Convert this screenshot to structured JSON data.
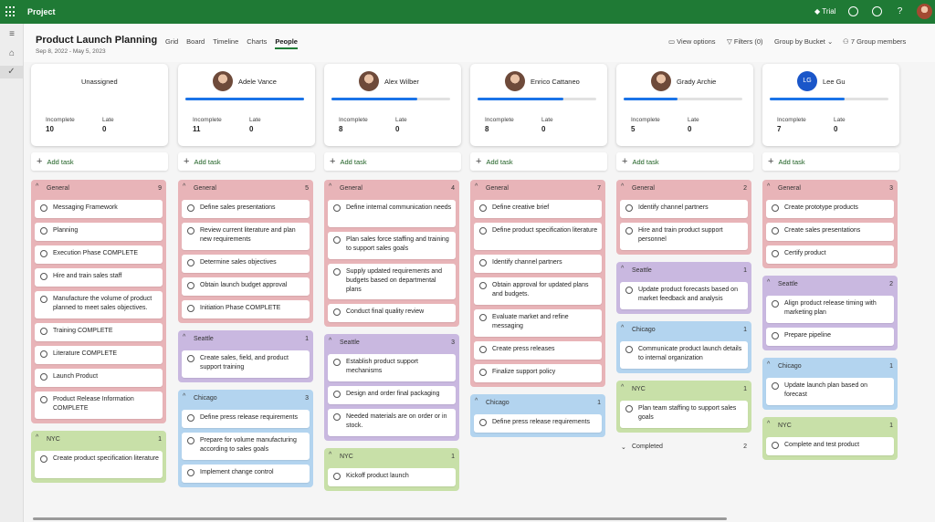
{
  "app": {
    "name": "Project",
    "trial": "Trial"
  },
  "plan": {
    "title": "Product Launch Planning",
    "date_range": "Sep 8, 2022 - May 5, 2023"
  },
  "tabs": [
    {
      "label": "Grid"
    },
    {
      "label": "Board"
    },
    {
      "label": "Timeline"
    },
    {
      "label": "Charts"
    },
    {
      "label": "People",
      "active": true
    }
  ],
  "controls": {
    "view_options": "View options",
    "filters": "Filters (0)",
    "group_by": "Group by Bucket",
    "members": "7 Group members"
  },
  "labels": {
    "incomplete": "Incomplete",
    "late": "Late",
    "add_task": "Add task",
    "completed": "Completed"
  },
  "colors": {
    "topbar": "#1f7a35",
    "progress": "#1a73e8",
    "general": "#e8b4b8",
    "seattle": "#c9b8e0",
    "chicago": "#b3d4ef",
    "nyc": "#c8e0a8"
  },
  "columns": [
    {
      "name": "Unassigned",
      "avatar": "none",
      "progress": 0,
      "incomplete": "10",
      "late": "0",
      "buckets": [
        {
          "name": "General",
          "count": "9",
          "tasks": [
            "Messaging Framework",
            "Planning",
            "Execution Phase COMPLETE",
            "Hire and train sales staff",
            "Manufacture the volume of product planned to meet sales objectives.",
            "Training COMPLETE",
            "Literature COMPLETE",
            "Launch Product",
            "Product Release Information COMPLETE"
          ]
        },
        {
          "name": "NYC",
          "count": "1",
          "tasks": [
            "Create product specification literature"
          ]
        }
      ]
    },
    {
      "name": "Adele Vance",
      "avatar": "photo",
      "progress": 1.0,
      "incomplete": "11",
      "late": "0",
      "buckets": [
        {
          "name": "General",
          "count": "5",
          "tasks": [
            "Define sales presentations",
            "Review current literature and plan new requirements",
            "Determine sales objectives",
            "Obtain launch budget approval",
            "Initiation Phase COMPLETE"
          ]
        },
        {
          "name": "Seattle",
          "count": "1",
          "tasks": [
            "Create sales, field, and product support training"
          ]
        },
        {
          "name": "Chicago",
          "count": "3",
          "tasks": [
            "Define press release requirements",
            "Prepare for volume manufacturing according to sales goals",
            "Implement change control"
          ]
        }
      ]
    },
    {
      "name": "Alex Wilber",
      "avatar": "photo",
      "progress": 0.72,
      "incomplete": "8",
      "late": "0",
      "buckets": [
        {
          "name": "General",
          "count": "4",
          "tasks": [
            "Define internal communication needs",
            "Plan sales force staffing and training to support sales goals",
            "Supply updated requirements and budgets based on departmental plans",
            "Conduct final quality review"
          ]
        },
        {
          "name": "Seattle",
          "count": "3",
          "tasks": [
            "Establish product support mechanisms",
            "Design and order final packaging",
            "Needed materials are on order or in stock."
          ]
        },
        {
          "name": "NYC",
          "count": "1",
          "tasks": [
            "Kickoff product launch"
          ]
        }
      ]
    },
    {
      "name": "Enrico Cattaneo",
      "avatar": "photo",
      "progress": 0.72,
      "incomplete": "8",
      "late": "0",
      "buckets": [
        {
          "name": "General",
          "count": "7",
          "tasks": [
            "Define creative brief",
            "Define product specification literature",
            "Identify channel partners",
            "Obtain approval for updated plans and budgets.",
            "Evaluate market and refine messaging",
            "Create press releases",
            "Finalize support policy"
          ]
        },
        {
          "name": "Chicago",
          "count": "1",
          "tasks": [
            "Define press release requirements"
          ]
        }
      ]
    },
    {
      "name": "Grady Archie",
      "avatar": "photo",
      "progress": 0.45,
      "incomplete": "5",
      "late": "0",
      "buckets": [
        {
          "name": "General",
          "count": "2",
          "tasks": [
            "Identify channel partners",
            "Hire and train product support personnel"
          ]
        },
        {
          "name": "Seattle",
          "count": "1",
          "tasks": [
            "Update product forecasts based on market feedback and analysis"
          ]
        },
        {
          "name": "Chicago",
          "count": "1",
          "tasks": [
            "Communicate product launch details to internal organization"
          ]
        },
        {
          "name": "NYC",
          "count": "1",
          "tasks": [
            "Plan team staffing to support sales goals"
          ]
        }
      ],
      "completed_count": "2"
    },
    {
      "name": "Lee Gu",
      "avatar": "LG",
      "progress": 0.63,
      "incomplete": "7",
      "late": "0",
      "buckets": [
        {
          "name": "General",
          "count": "3",
          "tasks": [
            "Create prototype products",
            "Create sales presentations",
            "Certify product"
          ]
        },
        {
          "name": "Seattle",
          "count": "2",
          "tasks": [
            "Align product release timing with marketing plan",
            "Prepare pipeline"
          ]
        },
        {
          "name": "Chicago",
          "count": "1",
          "tasks": [
            "Update launch plan based on forecast"
          ]
        },
        {
          "name": "NYC",
          "count": "1",
          "tasks": [
            "Complete and test product"
          ]
        }
      ]
    }
  ]
}
